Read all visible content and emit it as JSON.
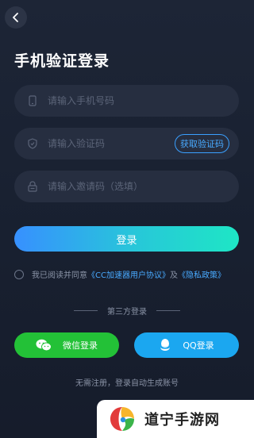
{
  "header": {
    "back_icon": "chevron-left-icon",
    "title": "手机验证登录"
  },
  "form": {
    "phone": {
      "icon": "phone-icon",
      "placeholder": "请输入手机号码",
      "value": ""
    },
    "code": {
      "icon": "shield-icon",
      "placeholder": "请输入验证码",
      "value": "",
      "get_code_label": "获取验证码"
    },
    "invite": {
      "icon": "lock-icon",
      "placeholder": "请输入邀请码（选填）",
      "value": ""
    }
  },
  "login_label": "登录",
  "agreement": {
    "prefix": "我已阅读并同意",
    "user_agreement": "《CC加速器用户协议》",
    "and": "及",
    "privacy_policy": "《隐私政策》"
  },
  "third_party": {
    "title": "第三方登录",
    "wechat_label": "微信登录",
    "qq_label": "QQ登录"
  },
  "hint": "无需注册，登录自动生成账号",
  "watermark": {
    "text": "道宁手游网"
  },
  "colors": {
    "accent": "#49aaff",
    "wechat": "#23c137",
    "qq": "#1ba7f0",
    "background": "#1b2233"
  }
}
